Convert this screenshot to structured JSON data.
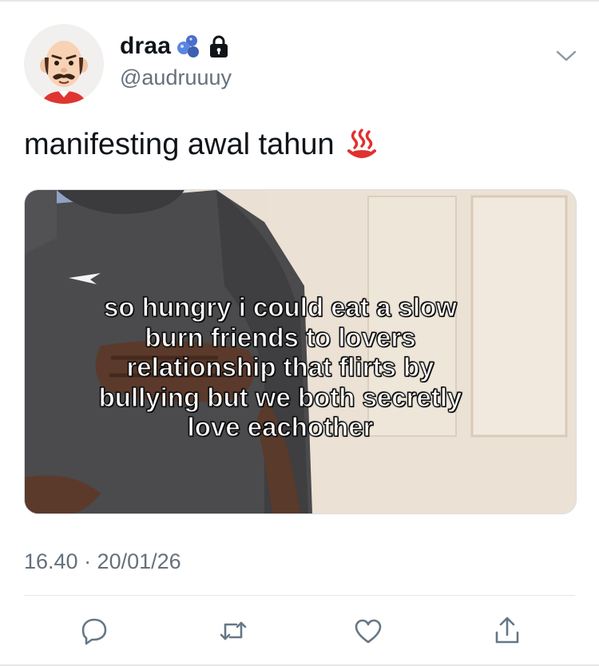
{
  "user": {
    "display_name": "draa",
    "handle": "@audruuuy",
    "avatar_icon": "cartoon-bald-mustache-face",
    "name_emoji_icon": "blue-sparkles-icon",
    "protected_icon": "lock-icon"
  },
  "tweet": {
    "text": "manifesting awal tahun",
    "emoji_icon": "hot-springs-icon",
    "image_caption": "so hungry i could eat a slow burn friends to lovers relationship that flirts by bullying but we both secretly love eachother",
    "timestamp": "16.40 · 20/01/26"
  },
  "actions": [
    "reply-icon",
    "retweet-icon",
    "like-icon",
    "share-icon"
  ],
  "colors": {
    "text": "#0f1419",
    "secondary": "#65707b",
    "icon": "#657786",
    "divider": "#e1e8ed",
    "emoji_red": "#e0312f"
  }
}
